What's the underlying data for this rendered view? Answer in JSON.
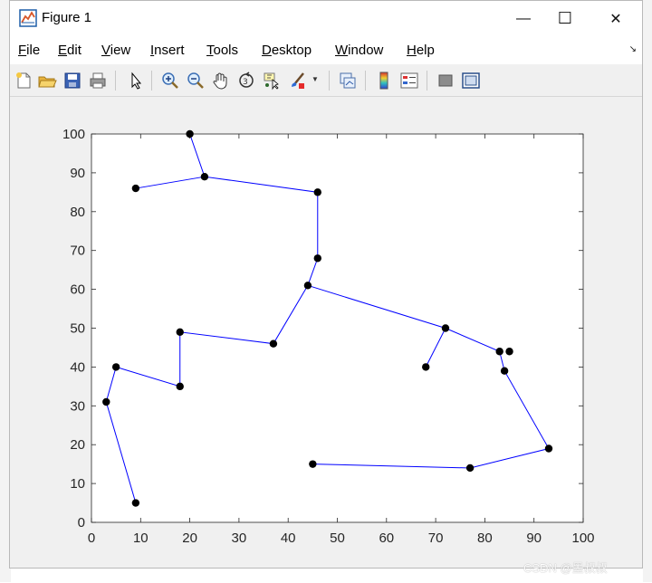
{
  "window": {
    "title": "Figure 1",
    "minimize_glyph": "—",
    "maximize_glyph": "☐",
    "close_glyph": "✕"
  },
  "menu": {
    "items": [
      {
        "pre": "",
        "u": "F",
        "post": "ile"
      },
      {
        "pre": "",
        "u": "E",
        "post": "dit"
      },
      {
        "pre": "",
        "u": "V",
        "post": "iew"
      },
      {
        "pre": "",
        "u": "I",
        "post": "nsert"
      },
      {
        "pre": "",
        "u": "T",
        "post": "ools"
      },
      {
        "pre": "",
        "u": "D",
        "post": "esktop"
      },
      {
        "pre": "",
        "u": "W",
        "post": "indow"
      },
      {
        "pre": "",
        "u": "H",
        "post": "elp"
      }
    ],
    "overflow_glyph": "↘"
  },
  "toolbar": {
    "icons": [
      "new-figure-icon",
      "open-file-icon",
      "save-icon",
      "print-icon",
      "pointer-icon",
      "zoom-in-icon",
      "zoom-out-icon",
      "pan-hand-icon",
      "rotate-3d-icon",
      "data-cursor-icon",
      "brush-icon",
      "brush-dropdown-icon",
      "link-plot-icon",
      "colorbar-icon",
      "legend-icon",
      "hide-plot-tools-icon",
      "show-plot-tools-icon"
    ]
  },
  "chart_data": {
    "type": "line",
    "title": "",
    "xlabel": "",
    "ylabel": "",
    "xlim": [
      0,
      100
    ],
    "ylim": [
      0,
      100
    ],
    "xticks": [
      0,
      10,
      20,
      30,
      40,
      50,
      60,
      70,
      80,
      90,
      100
    ],
    "yticks": [
      0,
      10,
      20,
      30,
      40,
      50,
      60,
      70,
      80,
      90,
      100
    ],
    "line_color": "#0000ff",
    "marker_color": "#000000",
    "path": [
      [
        9,
        5
      ],
      [
        3,
        31
      ],
      [
        5,
        40
      ],
      [
        18,
        35
      ],
      [
        18,
        49
      ],
      [
        37,
        46
      ],
      [
        44,
        61
      ],
      [
        46,
        68
      ],
      [
        46,
        85
      ],
      [
        23,
        89
      ],
      [
        20,
        100
      ]
    ],
    "path2": [
      [
        9,
        86
      ],
      [
        23,
        89
      ]
    ],
    "path3": [
      [
        44,
        61
      ],
      [
        72,
        50
      ],
      [
        83,
        44
      ],
      [
        84,
        39
      ],
      [
        93,
        19
      ],
      [
        77,
        14
      ],
      [
        45,
        15
      ]
    ],
    "path4": [
      [
        68,
        40
      ],
      [
        72,
        50
      ]
    ],
    "points": [
      [
        20,
        100
      ],
      [
        23,
        89
      ],
      [
        9,
        86
      ],
      [
        46,
        85
      ],
      [
        46,
        68
      ],
      [
        44,
        61
      ],
      [
        72,
        50
      ],
      [
        18,
        49
      ],
      [
        37,
        46
      ],
      [
        83,
        44
      ],
      [
        85,
        44
      ],
      [
        5,
        40
      ],
      [
        68,
        40
      ],
      [
        84,
        39
      ],
      [
        18,
        35
      ],
      [
        3,
        31
      ],
      [
        93,
        19
      ],
      [
        45,
        15
      ],
      [
        77,
        14
      ],
      [
        9,
        5
      ]
    ]
  },
  "watermark": "CSDN @墨叔叔"
}
